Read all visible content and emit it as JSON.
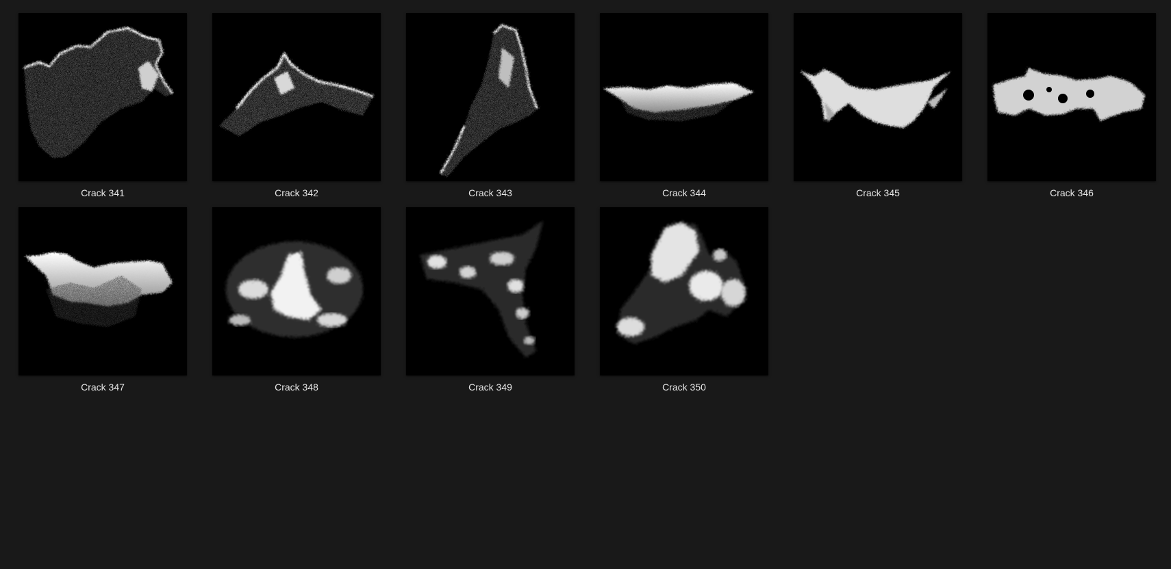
{
  "gallery": {
    "items": [
      {
        "label": "Crack 341"
      },
      {
        "label": "Crack 342"
      },
      {
        "label": "Crack 343"
      },
      {
        "label": "Crack 344"
      },
      {
        "label": "Crack 345"
      },
      {
        "label": "Crack 346"
      },
      {
        "label": "Crack 347"
      },
      {
        "label": "Crack 348"
      },
      {
        "label": "Crack 349"
      },
      {
        "label": "Crack 350"
      }
    ]
  }
}
